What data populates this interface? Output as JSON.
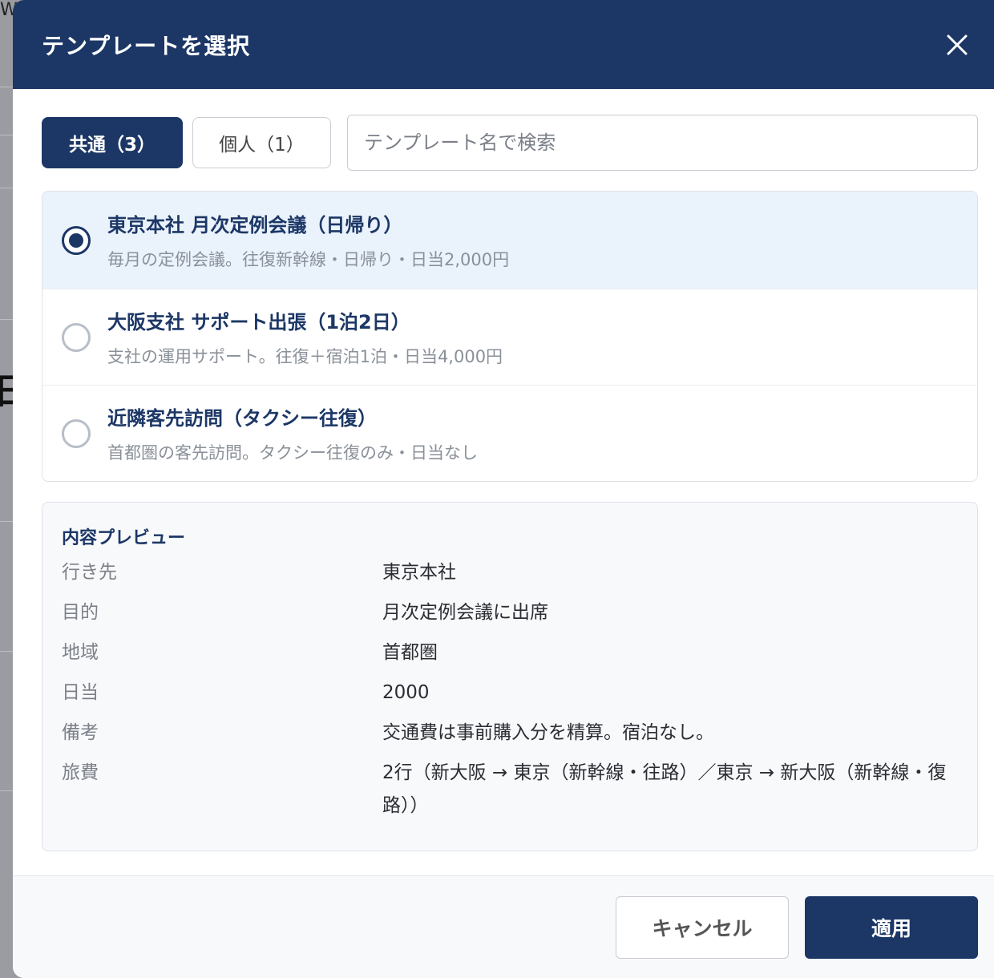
{
  "background": {
    "letter_top": "W",
    "letter_mid": "日"
  },
  "dialog": {
    "title": "テンプレートを選択",
    "close_icon": "close-icon"
  },
  "tabs": [
    {
      "label": "共通（3）",
      "active": true
    },
    {
      "label": "個人（1）",
      "active": false
    }
  ],
  "search": {
    "placeholder": "テンプレート名で検索",
    "value": ""
  },
  "templates": [
    {
      "title": "東京本社 月次定例会議（日帰り）",
      "description": "毎月の定例会議。往復新幹線・日帰り・日当2,000円",
      "selected": true
    },
    {
      "title": "大阪支社 サポート出張（1泊2日）",
      "description": "支社の運用サポート。往復＋宿泊1泊・日当4,000円",
      "selected": false
    },
    {
      "title": "近隣客先訪問（タクシー往復）",
      "description": "首都圏の客先訪問。タクシー往復のみ・日当なし",
      "selected": false
    }
  ],
  "preview": {
    "heading": "内容プレビュー",
    "rows": [
      {
        "label": "行き先",
        "value": "東京本社"
      },
      {
        "label": "目的",
        "value": "月次定例会議に出席"
      },
      {
        "label": "地域",
        "value": "首都圏"
      },
      {
        "label": "日当",
        "value": "2000"
      },
      {
        "label": "備考",
        "value": "交通費は事前購入分を精算。宿泊なし。"
      },
      {
        "label": "旅費",
        "value": "2行（新大阪 → 東京（新幹線・往路）／東京 → 新大阪（新幹線・復路））"
      }
    ]
  },
  "footer": {
    "cancel_label": "キャンセル",
    "apply_label": "適用"
  },
  "colors": {
    "primary": "#1c3766",
    "selected_bg": "#eaf2fb",
    "muted_text": "#8a9099"
  }
}
